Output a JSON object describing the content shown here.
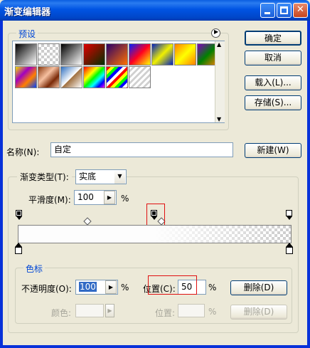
{
  "window": {
    "title": "渐变编辑器"
  },
  "titlebar_buttons": {
    "minimize": "_",
    "maximize": "□",
    "close": "✕"
  },
  "presets": {
    "label": "预设",
    "menu_icon": "▶",
    "scroll_up": "▲",
    "scroll_down": "▼",
    "swatch_icons": [
      "gradient-fg-bg",
      "gradient-fg-transparent",
      "gradient-black-white",
      "gradient-red-green",
      "gradient-violet-orange",
      "gradient-blue-red-yellow",
      "gradient-blue-yellow-blue",
      "gradient-orange-yellow-orange",
      "gradient-violet-green-orange",
      "gradient-yellow-violet-orange-blue",
      "gradient-copper",
      "gradient-chrome",
      "gradient-spectrum",
      "gradient-transparent-rainbow",
      "gradient-transparent-stripes"
    ]
  },
  "buttons": {
    "ok": "确定",
    "cancel": "取消",
    "load": "载入(L)...",
    "save": "存储(S)...",
    "new": "新建(W)",
    "delete_opacity": "删除(D)",
    "delete_color": "删除(D)"
  },
  "name": {
    "label": "名称(N):",
    "value": "自定"
  },
  "gradient_type": {
    "label": "渐变类型(T):",
    "value": "实底",
    "arrow": "▼"
  },
  "smoothness": {
    "label": "平滑度(M):",
    "value": "100",
    "unit": "%",
    "arrow": "▶"
  },
  "stops": {
    "group_label": "色标",
    "opacity_label": "不透明度(O):",
    "opacity_value": "100",
    "opacity_unit": "%",
    "opacity_location_label": "位置(C):",
    "opacity_location_value": "50",
    "opacity_location_unit": "%",
    "color_label": "颜色:",
    "color_location_label": "位置:",
    "color_location_unit": "%",
    "arrow": "▶"
  },
  "colors": {
    "accent": "#0046d5",
    "highlight": "#e01010",
    "titlebar": "#0054e3"
  }
}
